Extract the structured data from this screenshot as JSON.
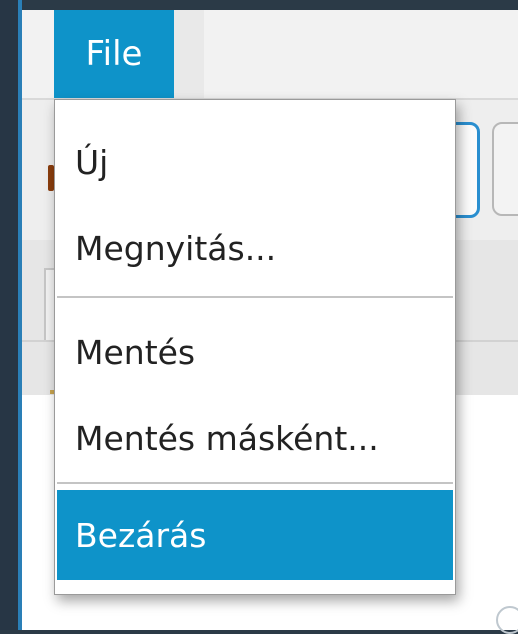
{
  "menubar": {
    "file_label": "File"
  },
  "file_menu": {
    "items": [
      {
        "label": "Új"
      },
      {
        "label": "Megnyitás..."
      },
      {
        "label": "Mentés"
      },
      {
        "label": "Mentés másként..."
      },
      {
        "label": "Bezárás",
        "selected": true
      }
    ]
  },
  "colors": {
    "accent": "#0e93c9",
    "desktop": "#2b3a47"
  }
}
